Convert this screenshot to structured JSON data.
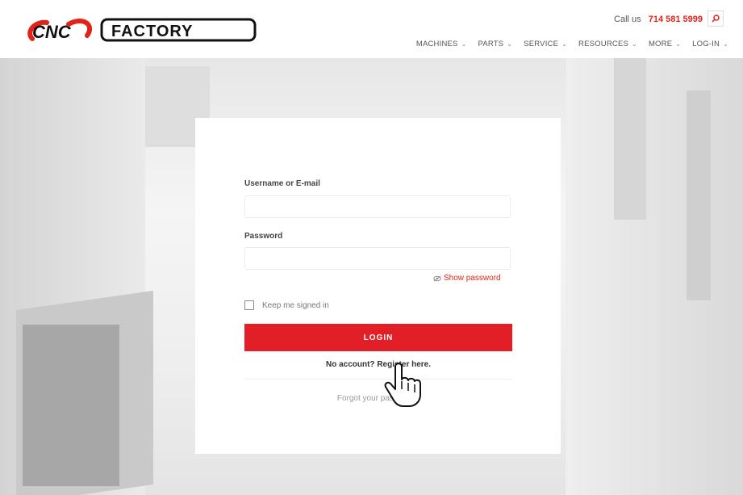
{
  "brand": {
    "logo_left": "CNC",
    "logo_right": "FACTORY",
    "accent": "#e2231a"
  },
  "header": {
    "call_label": "Call us",
    "phone": "714 581 5999",
    "search_icon": "search-icon",
    "nav": [
      {
        "label": "MACHINES"
      },
      {
        "label": "PARTS"
      },
      {
        "label": "SERVICE"
      },
      {
        "label": "RESOURCES"
      },
      {
        "label": "MORE"
      },
      {
        "label": "LOG-IN"
      }
    ]
  },
  "login": {
    "username_label": "Username or E-mail",
    "username_value": "",
    "password_label": "Password",
    "password_value": "",
    "show_password": "Show password",
    "keep_signed_in": "Keep me signed in",
    "login_button": "LOGIN",
    "register_text": "No account? Register here.",
    "forgot_text": "Forgot your password?"
  }
}
